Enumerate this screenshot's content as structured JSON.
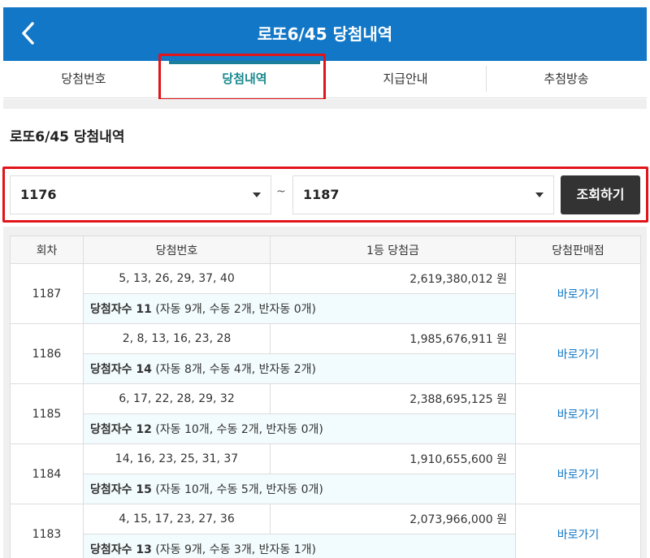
{
  "header": {
    "title": "로또6/45 당첨내역"
  },
  "tabs": [
    {
      "label": "당첨번호"
    },
    {
      "label": "당첨내역"
    },
    {
      "label": "지급안내"
    },
    {
      "label": "추첨방송"
    }
  ],
  "page_title": "로또6/45 당첨내역",
  "search": {
    "from_value": "1176",
    "separator": "~",
    "to_value": "1187",
    "button_label": "조회하기"
  },
  "table": {
    "headers": {
      "round": "회차",
      "numbers": "당첨번호",
      "first_prize": "1등 당첨금",
      "store": "당첨판매점"
    },
    "rows": [
      {
        "round": "1187",
        "numbers": "5, 13, 26, 29, 37, 40",
        "amount": "2,619,380,012 원",
        "winners_label": "당첨자수 11",
        "winners_detail": " (자동 9개, 수동 2개, 반자동 0개)",
        "store_link": "바로가기"
      },
      {
        "round": "1186",
        "numbers": "2, 8, 13, 16, 23, 28",
        "amount": "1,985,676,911 원",
        "winners_label": "당첨자수 14",
        "winners_detail": " (자동 8개, 수동 4개, 반자동 2개)",
        "store_link": "바로가기"
      },
      {
        "round": "1185",
        "numbers": "6, 17, 22, 28, 29, 32",
        "amount": "2,388,695,125 원",
        "winners_label": "당첨자수 12",
        "winners_detail": " (자동 10개, 수동 2개, 반자동 0개)",
        "store_link": "바로가기"
      },
      {
        "round": "1184",
        "numbers": "14, 16, 23, 25, 31, 37",
        "amount": "1,910,655,600 원",
        "winners_label": "당첨자수 15",
        "winners_detail": " (자동 10개, 수동 5개, 반자동 0개)",
        "store_link": "바로가기"
      },
      {
        "round": "1183",
        "numbers": "4, 15, 17, 23, 27, 36",
        "amount": "2,073,966,000 원",
        "winners_label": "당첨자수 13",
        "winners_detail": " (자동 9개, 수동 3개, 반자동 1개)",
        "store_link": "바로가기"
      }
    ]
  }
}
